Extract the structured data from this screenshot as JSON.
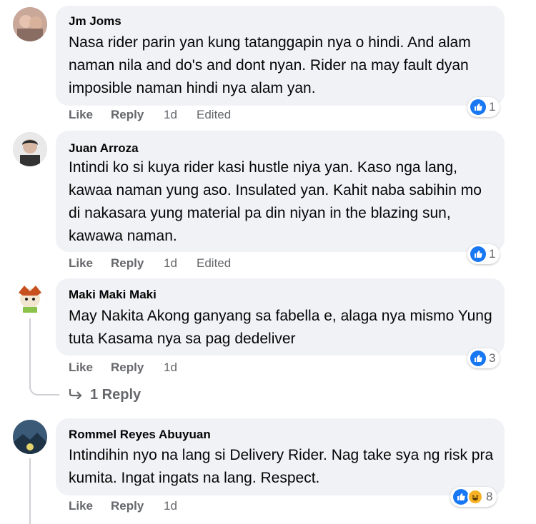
{
  "comments": [
    {
      "name": "Jm Joms",
      "text": "Nasa rider parin yan kung tatanggapin nya o hindi. And alam naman nila and do's and dont nyan. Rider na may fault dyan imposible naman hindi nya alam yan.",
      "like": "Like",
      "reply": "Reply",
      "time": "1d",
      "edited": "Edited",
      "reactions": "1"
    },
    {
      "name": "Juan Arroza",
      "text": "Intindi ko si kuya rider kasi hustle niya yan. Kaso nga lang, kawaa naman yung aso. Insulated yan. Kahit naba sabihin mo di nakasara yung material pa din niyan in the blazing sun, kawawa naman.",
      "like": "Like",
      "reply": "Reply",
      "time": "1d",
      "edited": "Edited",
      "reactions": "1"
    },
    {
      "name": "Maki Maki Maki",
      "text": "May Nakita Akong ganyang sa fabella e, alaga nya mismo Yung tuta Kasama nya sa pag dedeliver",
      "like": "Like",
      "reply": "Reply",
      "time": "1d",
      "reactions": "3",
      "replies_label": "1 Reply"
    },
    {
      "name": "Rommel Reyes Abuyuan",
      "text": "Intindihin nyo na lang si Delivery Rider. Nag take sya ng risk pra kumita. Ingat ingats na lang. Respect.",
      "like": "Like",
      "reply": "Reply",
      "time": "1d",
      "reactions": "8"
    }
  ],
  "colors": {
    "bubble": "#f0f2f5",
    "like_blue": "#1877f2",
    "meta_gray": "#65676b"
  },
  "icons": {
    "like": "thumbs-up-icon",
    "haha": "haha-emoji-icon",
    "reply_arrow": "reply-arrow-icon"
  }
}
